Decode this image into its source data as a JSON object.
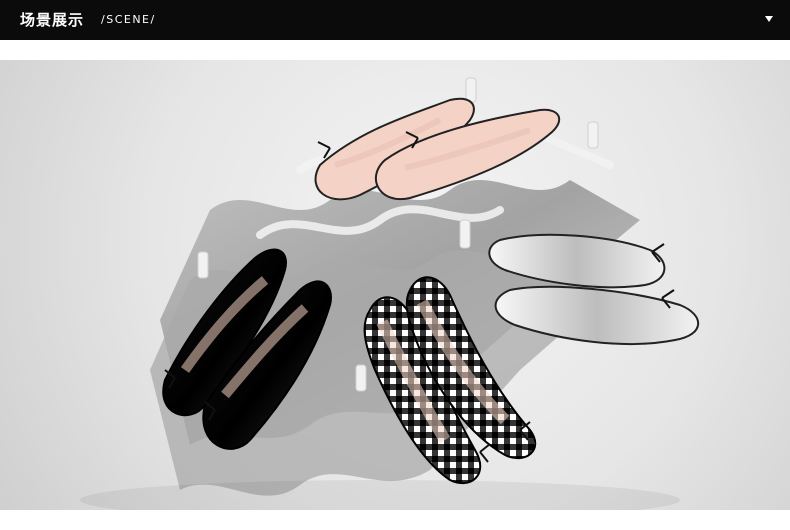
{
  "header": {
    "title_cn": "场景展示",
    "title_en": "/SCENE/",
    "dropdown_icon": "triangle-down-icon"
  },
  "scene": {
    "image_alt": ""
  },
  "colors": {
    "header_bg": "#0b0b0b",
    "header_text": "#ffffff"
  }
}
